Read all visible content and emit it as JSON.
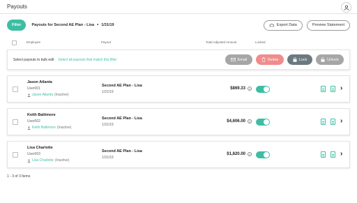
{
  "app": {
    "title": "Payouts"
  },
  "toolbar": {
    "filter_label": "Filter",
    "breadcrumb_plan": "Payouts for Second AE Plan - Lisa",
    "breadcrumb_sep": "•",
    "breadcrumb_date": "1/31/19",
    "export_label": "Export Data",
    "preview_label": "Preview Statement"
  },
  "columns": {
    "employee": "Employee",
    "payout": "Payout",
    "total": "Total Adjusted Amount",
    "locked": "Locked"
  },
  "bulk": {
    "prompt": "Select payouts to bulk edit",
    "select_all": "Select all payouts that match this filter",
    "email": "Email",
    "delete": "Delete",
    "lock": "Lock",
    "unlock": "Unlock"
  },
  "rows": [
    {
      "name": "Jason Atlanta",
      "user_id": "User001",
      "manager": "Jason Atlanta",
      "status": "(Inactive)",
      "payout": "Second AE Plan - Lisa",
      "date": "1/31/19",
      "amount": "$869.33",
      "locked": true
    },
    {
      "name": "Keith Baltimore",
      "user_id": "User002",
      "manager": "Keith Baltimore",
      "status": "(Inactive)",
      "payout": "Second AE Plan - Lisa",
      "date": "1/31/19",
      "amount": "$4,606.00",
      "locked": true
    },
    {
      "name": "Lisa Charlotte",
      "user_id": "User003",
      "manager": "Lisa Charlotte",
      "status": "(Inactive)",
      "payout": "Second AE Plan - Lisa",
      "date": "1/31/19",
      "amount": "$1,820.00",
      "locked": true
    }
  ],
  "footer": {
    "count": "1 - 3 of 3 Items"
  },
  "colors": {
    "accent": "#3dbea4",
    "delete": "#f08c8c",
    "lock": "#6b7a80",
    "muted": "#a6a6a6"
  },
  "icons": {
    "user": "user-icon",
    "export": "cloud-download-icon",
    "email": "mail-icon",
    "delete": "trash-icon",
    "lock": "lock-icon",
    "unlock": "unlock-icon",
    "person": "person-icon",
    "help": "help-icon",
    "document": "document-icon",
    "chevron": "chevron-right-icon"
  }
}
